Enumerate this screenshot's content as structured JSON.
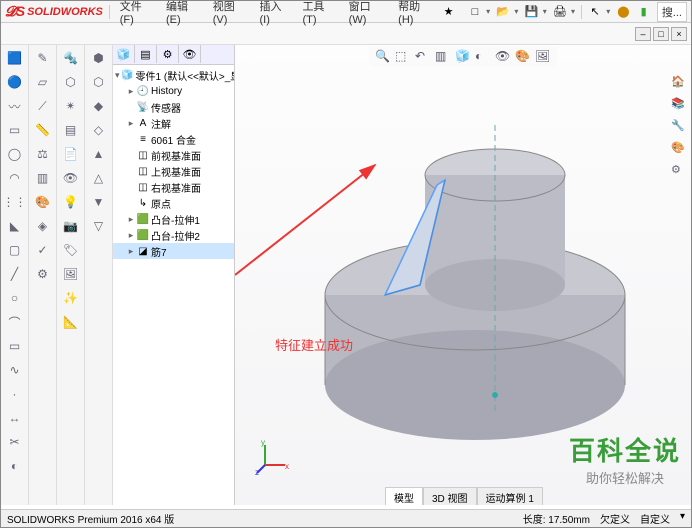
{
  "app": {
    "logo": "SOLIDWORKS"
  },
  "menu": {
    "file": "文件(F)",
    "edit": "编辑(E)",
    "view": "视图(V)",
    "insert": "插入(I)",
    "tools": "工具(T)",
    "window": "窗口(W)",
    "help": "帮助(H)",
    "search": "搜..."
  },
  "tree": {
    "root": "零件1 (默认<<默认>_显",
    "items": [
      {
        "icon": "🕘",
        "label": "History"
      },
      {
        "icon": "📡",
        "label": "传感器"
      },
      {
        "icon": "A",
        "label": "注解"
      },
      {
        "icon": "≡",
        "label": "6061 合金"
      },
      {
        "icon": "◫",
        "label": "前视基准面"
      },
      {
        "icon": "◫",
        "label": "上视基准面"
      },
      {
        "icon": "◫",
        "label": "右视基准面"
      },
      {
        "icon": "↳",
        "label": "原点"
      },
      {
        "icon": "🟩",
        "label": "凸台-拉伸1"
      },
      {
        "icon": "🟩",
        "label": "凸台-拉伸2"
      },
      {
        "icon": "◪",
        "label": "筋7",
        "selected": true
      }
    ]
  },
  "annotation": "特征建立成功",
  "bottom_tabs": {
    "t1": "模型",
    "t2": "3D 视图",
    "t3": "运动算例 1"
  },
  "status": {
    "left": "SOLIDWORKS Premium 2016 x64 版",
    "length": "长度: 17.50mm",
    "underdef": "欠定义",
    "custom": "自定义"
  },
  "watermark": {
    "big": "百科全说",
    "small": "助你轻松解决"
  }
}
